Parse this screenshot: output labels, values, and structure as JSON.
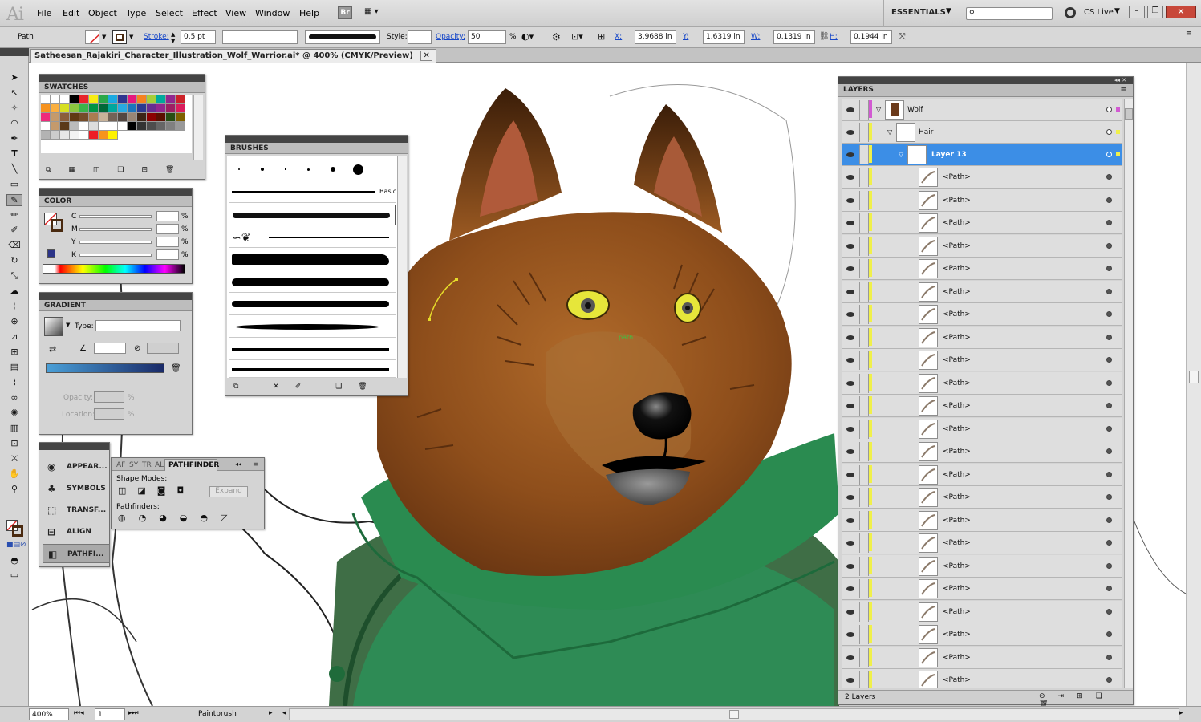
{
  "app": {
    "logo": "Ai"
  },
  "menu": [
    "File",
    "Edit",
    "Object",
    "Type",
    "Select",
    "Effect",
    "View",
    "Window",
    "Help"
  ],
  "topbar": {
    "br_button": "Br",
    "workspace": "ESSENTIALS",
    "search_placeholder": "",
    "cslive": "CS Live"
  },
  "control": {
    "selection_type": "Path",
    "stroke_label": "Stroke:",
    "stroke_weight": "0.5 pt",
    "style_label": "Style:",
    "opacity_label": "Opacity:",
    "opacity_value": "50",
    "opacity_unit": "%",
    "x_label": "X:",
    "x_value": "3.9688 in",
    "y_label": "Y:",
    "y_value": "1.6319 in",
    "w_label": "W:",
    "w_value": "0.1319 in",
    "h_label": "H:",
    "h_value": "0.1944 in"
  },
  "document": {
    "tab_title": "Satheesan_Rajakiri_Character_Illustration_Wolf_Warrior.ai* @ 400% (CMYK/Preview)"
  },
  "canvas": {
    "path_hint": "path"
  },
  "swatches": {
    "title": "SWATCHES"
  },
  "color": {
    "title": "COLOR",
    "channels": [
      "C",
      "M",
      "Y",
      "K"
    ],
    "unit": "%"
  },
  "gradient": {
    "title": "GRADIENT",
    "type_label": "Type:",
    "opacity_label": "Opacity:",
    "location_label": "Location:",
    "unit": "%"
  },
  "brushes": {
    "title": "BRUSHES",
    "basic_label": "Basic"
  },
  "dock": {
    "items": [
      "APPEAR...",
      "SYMBOLS",
      "TRANSF...",
      "ALIGN",
      "PATHFI..."
    ]
  },
  "pathfinder": {
    "tabs": [
      "AF",
      "SY",
      "TR",
      "AL"
    ],
    "title": "PATHFINDER",
    "shape_modes": "Shape Modes:",
    "expand": "Expand",
    "pathfinders": "Pathfinders:"
  },
  "layers": {
    "title": "LAYERS",
    "wolf": "Wolf",
    "hair": "Hair",
    "layer13": "Layer 13",
    "paths": [
      "<Path>",
      "<Path>",
      "<Path>",
      "<Path>",
      "<Path>",
      "<Path>",
      "<Path>",
      "<Path>",
      "<Path>",
      "<Path>",
      "<Path>",
      "<Path>",
      "<Path>",
      "<Path>",
      "<Path>",
      "<Path>",
      "<Path>",
      "<Path>",
      "<Path>",
      "<Path>",
      "<Path>",
      "<Path>",
      "<Path>"
    ],
    "footer": "2 Layers"
  },
  "status": {
    "zoom": "400%",
    "page": "1",
    "tool": "Paintbrush"
  }
}
